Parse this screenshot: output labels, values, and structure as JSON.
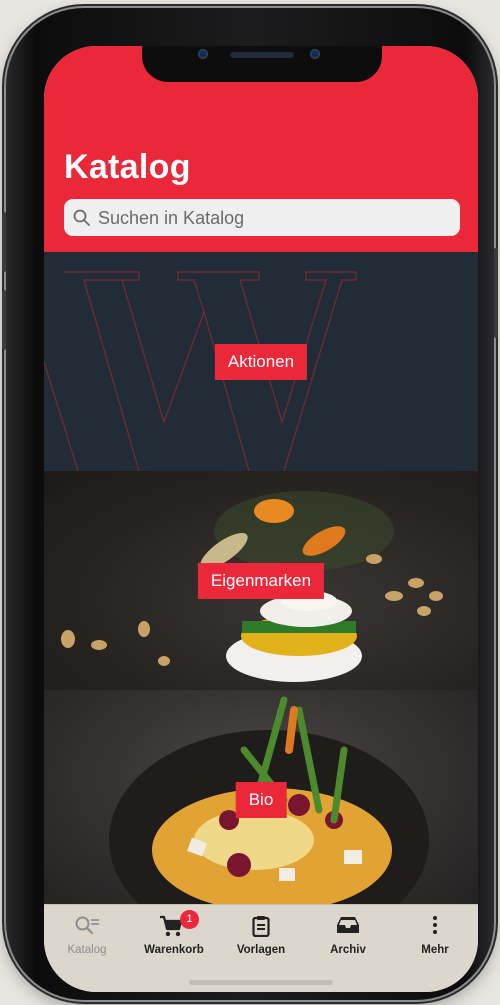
{
  "header": {
    "title": "Katalog",
    "search_placeholder": "Suchen in Katalog",
    "background_color": "#eb2839"
  },
  "categories": [
    {
      "label": "Aktionen"
    },
    {
      "label": "Eigenmarken"
    },
    {
      "label": "Bio"
    }
  ],
  "tabbar": {
    "items": [
      {
        "label": "Katalog",
        "icon": "search-list-icon",
        "active": true
      },
      {
        "label": "Warenkorb",
        "icon": "cart-icon",
        "badge": "1"
      },
      {
        "label": "Vorlagen",
        "icon": "clipboard-icon"
      },
      {
        "label": "Archiv",
        "icon": "inbox-tray-icon"
      },
      {
        "label": "Mehr",
        "icon": "more-vertical-icon"
      }
    ]
  },
  "colors": {
    "accent": "#eb2839",
    "dark_panel": "#222c36",
    "tabbar_bg": "#dcd6cd"
  }
}
